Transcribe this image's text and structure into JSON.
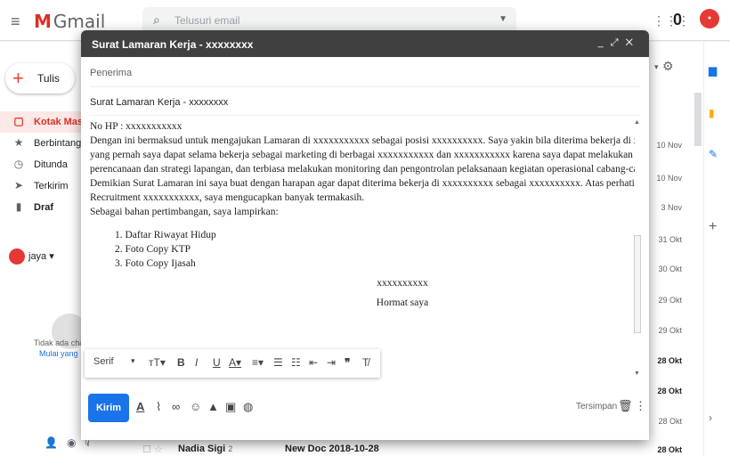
{
  "gmail": {
    "brand": "Gmail",
    "search_placeholder": "Telusuri email",
    "account_initial": "0",
    "compose_label": "Tulis",
    "nav": [
      {
        "label": "Kotak Masuk",
        "icon": "inbox-icon",
        "glyph": "▢"
      },
      {
        "label": "Berbintang",
        "icon": "star-icon",
        "glyph": "★"
      },
      {
        "label": "Ditunda",
        "icon": "clock-icon",
        "glyph": "◷"
      },
      {
        "label": "Terkirim",
        "icon": "send-icon",
        "glyph": "➤"
      },
      {
        "label": "Draf",
        "icon": "draft-icon",
        "glyph": "▮"
      }
    ],
    "user": "jaya",
    "no_chat": "Tidak ada chat",
    "start_chat": "Mulai yang",
    "dates": [
      "10 Nov",
      "10 Nov",
      "3 Nov",
      "31 Okt",
      "30 Okt",
      "29 Okt",
      "29 Okt",
      "28 Okt",
      "28 Okt",
      "28 Okt",
      "28 Okt"
    ],
    "bottom_sender": "Nadia Sigi",
    "bottom_sender_count": "2",
    "bottom_subject": "New Doc 2018-10-28"
  },
  "compose": {
    "title": "Surat Lamaran Kerja - xxxxxxxx",
    "to_placeholder": "Penerima",
    "subject": "Surat Lamaran Kerja  - xxxxxxxx",
    "body_lines": [
      "No HP          : xxxxxxxxxxx",
      "Dengan ini bermaksud untuk mengajukan Lamaran di  xxxxxxxxxxx sebagai posisi xxxxxxxxxx. Saya yakin bila diterima bekerja di xxxxxxxxxxx dapat menerapkan Ilmu",
      "yang pernah saya dapat selama bekerja sebagai marketing di berbagai xxxxxxxxxxx dan xxxxxxxxxxx karena saya dapat melakukan analisa secara efektif, mampu membuat",
      "perencanaan dan strategi lapangan, dan terbiasa melakukan monitoring dan pengontrolan pelaksanaan kegiatan operasional cabang-cabang yang pernah saya pegang.",
      "Demikian Surat Lamaran ini saya buat dengan harapan agar dapat diterima bekerja di xxxxxxxxxx sebagai xxxxxxxxxx.  Atas perhatian Bapak/Ibu Kepala HRD",
      "Recruitment xxxxxxxxxxx, saya mengucapkan banyak termakasih.",
      "Sebagai bahan pertimbangan, saya lampirkan:"
    ],
    "attachments": [
      "1.   Daftar Riwayat Hidup",
      "2.   Foto Copy KTP",
      "3.   Foto Copy Ijasah"
    ],
    "sign_name": "xxxxxxxxxx",
    "closing": "Hormat saya",
    "font_name": "Serif",
    "send_label": "Kirim",
    "saved_label": "Tersimpan"
  }
}
